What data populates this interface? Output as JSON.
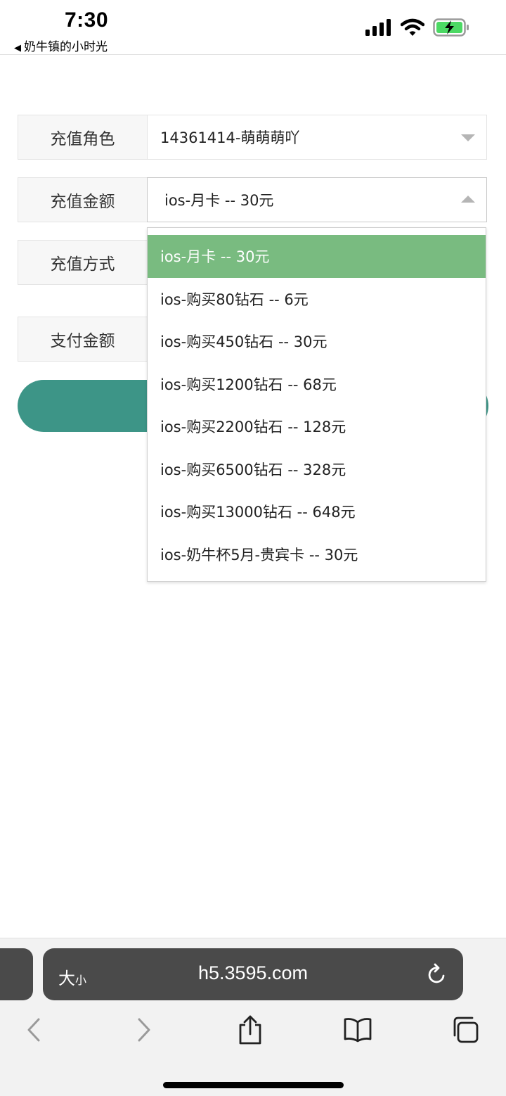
{
  "status_bar": {
    "time": "7:30",
    "back_app": "奶牛镇的小时光",
    "icons": [
      "signal-icon",
      "wifi-icon",
      "battery-charging-icon"
    ]
  },
  "form": {
    "role_label": "充值角色",
    "role_value": "14361414-萌萌萌吖",
    "amount_label": "充值金额",
    "amount_value": "ios-月卡 -- 30元",
    "method_label": "充值方式",
    "pay_amount_label": "支付金额"
  },
  "dropdown": {
    "options": [
      "ios-月卡 -- 30元",
      "ios-购买80钻石 -- 6元",
      "ios-购买450钻石 -- 30元",
      "ios-购买1200钻石 -- 68元",
      "ios-购买2200钻石 -- 128元",
      "ios-购买6500钻石 -- 328元",
      "ios-购买13000钻石 -- 648元",
      "ios-奶牛杯5月-贵宾卡 -- 30元"
    ],
    "selected_index": 0,
    "selected_color": "#79bb80"
  },
  "pay_button": {
    "color": "#3d9587"
  },
  "browser": {
    "text_size_big": "大",
    "text_size_small": "小",
    "url": "h5.3595.com"
  }
}
